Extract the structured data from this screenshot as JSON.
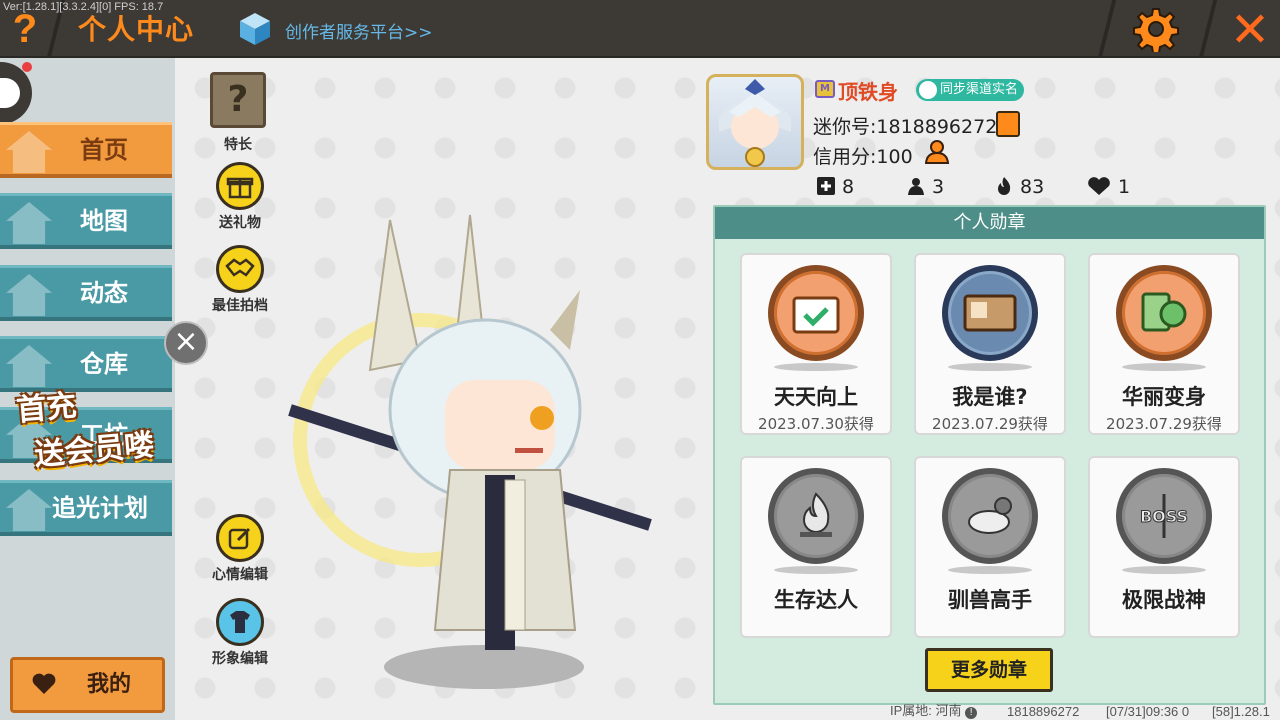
{
  "header": {
    "version_info": "Ver:[1.28.1][3.3.2.4][0] FPS: 18.7",
    "help_icon": "question-mark-icon",
    "title": "个人中心",
    "creator_link": "创作者服务平台>>",
    "settings_icon": "gear-icon",
    "close_icon": "close-icon",
    "accent_color": "#ff8a1c"
  },
  "sidebar": {
    "items": [
      {
        "label": "首页",
        "icon": "house-icon",
        "active": true
      },
      {
        "label": "地图",
        "icon": "map-icon",
        "active": false
      },
      {
        "label": "动态",
        "icon": "bell-icon",
        "active": false
      },
      {
        "label": "仓库",
        "icon": "warehouse-icon",
        "active": false
      },
      {
        "label": "工坊",
        "icon": "workshop-icon",
        "active": false
      },
      {
        "label": "追光计划",
        "icon": "puzzle-icon",
        "active": false
      }
    ],
    "promo": {
      "line1": "首充",
      "line2": "送会员喽"
    },
    "mine_label": "我的"
  },
  "actions": {
    "talent": "特长",
    "gift": "送礼物",
    "best_partner": "最佳拍档",
    "mood_edit": "心情编辑",
    "avatar_edit": "形象编辑"
  },
  "profile": {
    "name": "顶铁身",
    "verify_label": "同步渠道实名",
    "mini_id": "迷你号:1818896272",
    "credit": "信用分:100",
    "stats": [
      {
        "icon": "plus-square-icon",
        "value": "8"
      },
      {
        "icon": "fans-icon",
        "value": "3"
      },
      {
        "icon": "flame-icon",
        "value": "83"
      },
      {
        "icon": "heart-icon",
        "value": "1"
      }
    ]
  },
  "badges": {
    "title": "个人勋章",
    "items": [
      {
        "name": "天天向上",
        "date": "2023.07.30获得",
        "earned": true
      },
      {
        "name": "我是谁?",
        "date": "2023.07.29获得",
        "earned": true
      },
      {
        "name": "华丽变身",
        "date": "2023.07.29获得",
        "earned": true
      },
      {
        "name": "生存达人",
        "date": "",
        "earned": false
      },
      {
        "name": "驯兽高手",
        "date": "",
        "earned": false
      },
      {
        "name": "极限战神",
        "date": "",
        "earned": false
      }
    ],
    "more_label": "更多勋章"
  },
  "footer": {
    "ip_location": "IP属地: 河南",
    "user_id": "1818896272",
    "session": "[07/31]09:36 0",
    "build": "[58]1.28.1"
  }
}
